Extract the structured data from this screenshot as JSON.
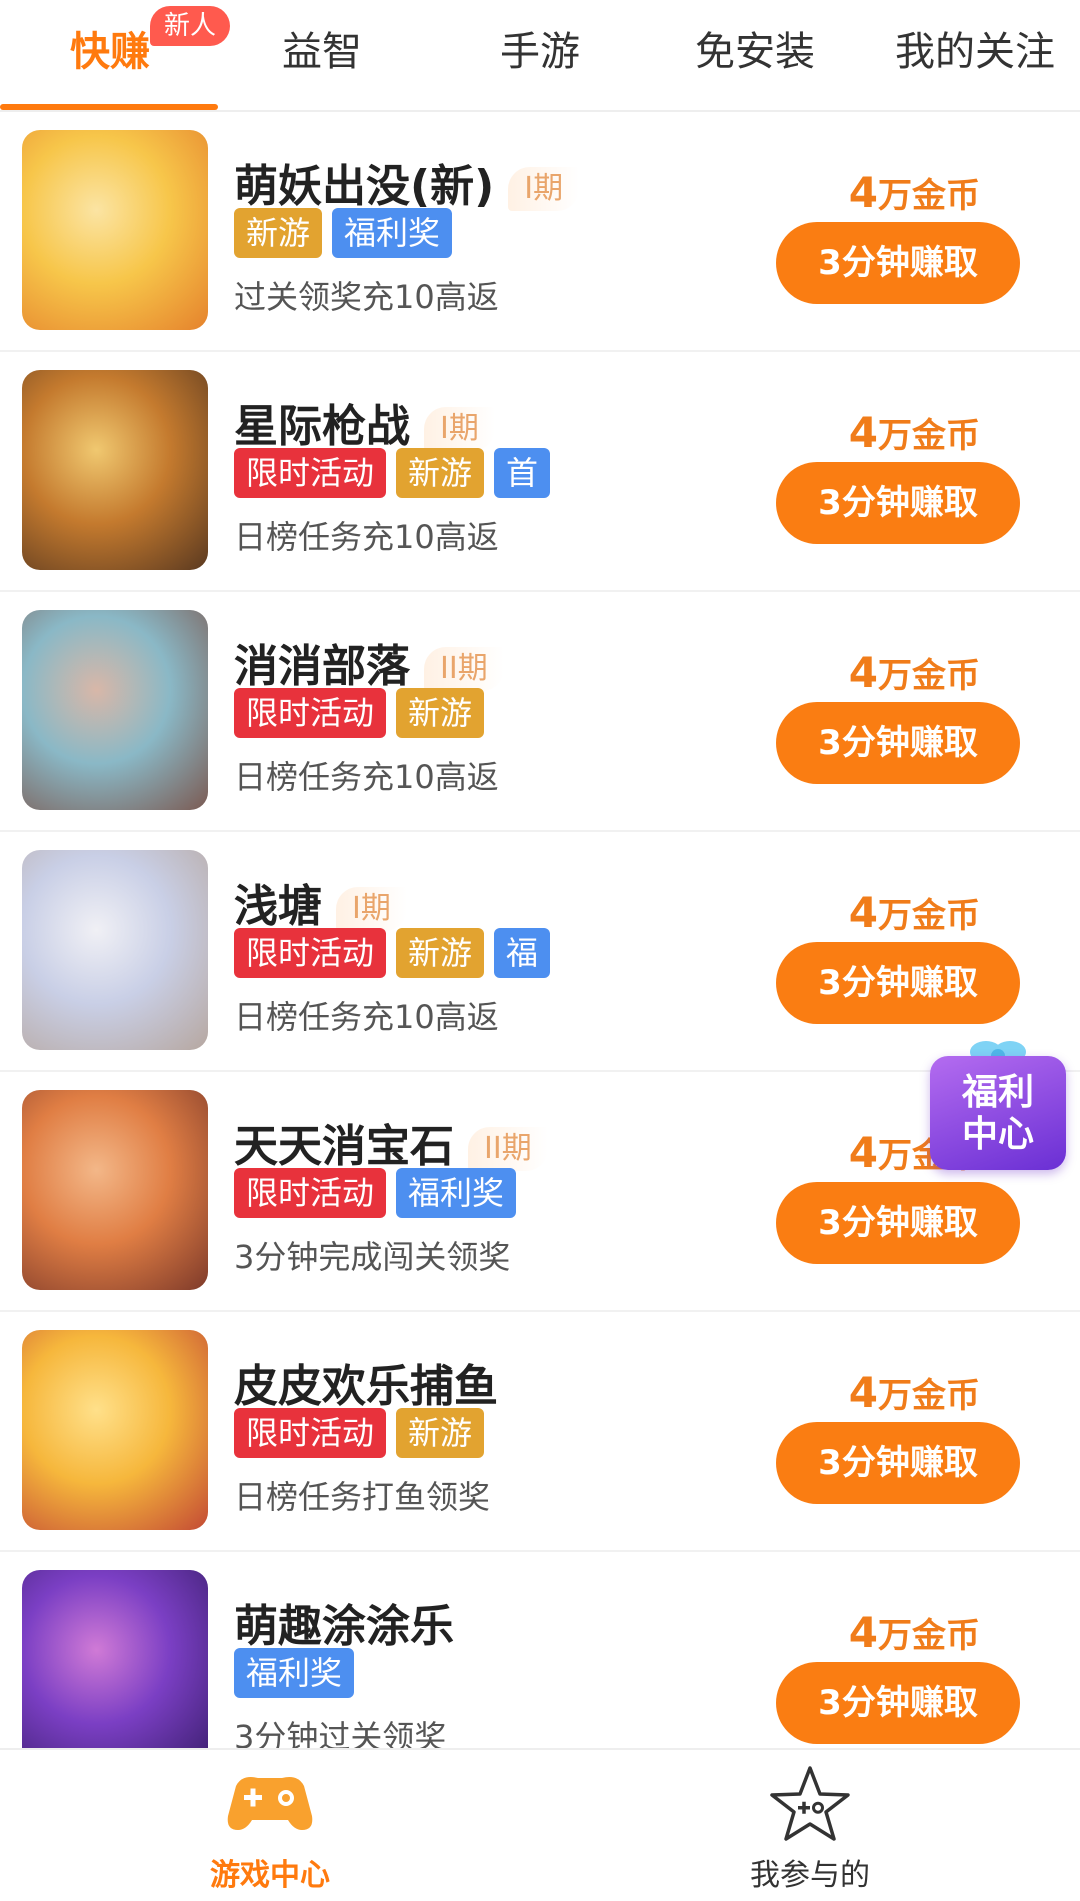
{
  "tabs": {
    "items": [
      "快赚",
      "益智",
      "手游",
      "免安装",
      "我的关注"
    ],
    "active": "快赚",
    "new_badge": "新人"
  },
  "games": [
    {
      "title": "萌妖出没(新)",
      "period": "I期",
      "tags": [
        {
          "text": "新游",
          "type": "new"
        },
        {
          "text": "福利奖",
          "type": "welfare"
        }
      ],
      "desc": "过关领奖充10高返",
      "reward_num": "4",
      "reward_unit": "万金币",
      "button": "3分钟赚取",
      "thumb_colors": [
        "#f7c64a",
        "#e5822c",
        "#fbe4a3"
      ]
    },
    {
      "title": "星际枪战",
      "period": "I期",
      "tags": [
        {
          "text": "限时活动",
          "type": "limited"
        },
        {
          "text": "新游",
          "type": "new"
        },
        {
          "text": "首",
          "type": "welfare"
        }
      ],
      "desc": "日榜任务充10高返",
      "reward_num": "4",
      "reward_unit": "万金币",
      "button": "3分钟赚取",
      "thumb_colors": [
        "#c47a2e",
        "#5a3920",
        "#f0c870"
      ]
    },
    {
      "title": "消消部落",
      "period": "II期",
      "tags": [
        {
          "text": "限时活动",
          "type": "limited"
        },
        {
          "text": "新游",
          "type": "new"
        }
      ],
      "desc": "日榜任务充10高返",
      "reward_num": "4",
      "reward_unit": "万金币",
      "button": "3分钟赚取",
      "thumb_colors": [
        "#8ab8c6",
        "#7b5a52",
        "#d8b7a8"
      ]
    },
    {
      "title": "浅塘",
      "period": "I期",
      "tags": [
        {
          "text": "限时活动",
          "type": "limited"
        },
        {
          "text": "新游",
          "type": "new"
        },
        {
          "text": "福",
          "type": "welfare"
        }
      ],
      "desc": "日榜任务充10高返",
      "reward_num": "4",
      "reward_unit": "万金币",
      "button": "3分钟赚取",
      "thumb_colors": [
        "#c9cfe6",
        "#b6a7a0",
        "#f0f0f5"
      ]
    },
    {
      "title": "天天消宝石",
      "period": "II期",
      "tags": [
        {
          "text": "限时活动",
          "type": "limited"
        },
        {
          "text": "福利奖",
          "type": "welfare"
        }
      ],
      "desc": "3分钟完成闯关领奖",
      "reward_num": "4",
      "reward_unit": "万金币",
      "button": "3分钟赚取",
      "thumb_colors": [
        "#e07e44",
        "#7e3a2a",
        "#f3b788"
      ]
    },
    {
      "title": "皮皮欢乐捕鱼",
      "period": "",
      "tags": [
        {
          "text": "限时活动",
          "type": "limited"
        },
        {
          "text": "新游",
          "type": "new"
        }
      ],
      "desc": "日榜任务打鱼领奖",
      "reward_num": "4",
      "reward_unit": "万金币",
      "button": "3分钟赚取",
      "thumb_colors": [
        "#f6b73c",
        "#c34a34",
        "#ffe08a"
      ]
    },
    {
      "title": "萌趣涂涂乐",
      "period": "",
      "tags": [
        {
          "text": "福利奖",
          "type": "welfare"
        }
      ],
      "desc": "3分钟过关领奖",
      "reward_num": "4",
      "reward_unit": "万金币",
      "button": "3分钟赚取",
      "thumb_colors": [
        "#7b3fc4",
        "#3a1e6c",
        "#d07ad6"
      ]
    }
  ],
  "welfare_center": {
    "label_line1": "福利",
    "label_line2": "中心"
  },
  "bottom_nav": {
    "items": [
      {
        "label": "游戏中心",
        "icon": "gamepad-icon",
        "active": true
      },
      {
        "label": "我参与的",
        "icon": "star-icon",
        "active": false
      }
    ]
  },
  "colors": {
    "accent": "#ff7a0e",
    "button": "#fa7d12",
    "tag_new": "#e2a330",
    "tag_welfare": "#4d8ff0",
    "tag_limited": "#e8323c"
  }
}
